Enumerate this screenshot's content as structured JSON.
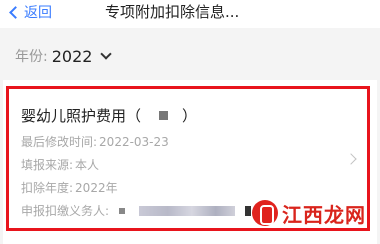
{
  "header": {
    "back_label": "返回",
    "title": "专项附加扣除信息..."
  },
  "filter": {
    "year_label": "年份:",
    "year_value": "2022"
  },
  "record": {
    "title": "婴幼儿照护费用（",
    "title_close": "）",
    "modified_label": "最后修改时间:",
    "modified_value": "2022-03-23",
    "source_label": "填报来源:",
    "source_value": "本人",
    "deduct_year_label": "扣除年度:",
    "deduct_year_value": "2022年",
    "withholder_label": "申报扣缴义务人:"
  },
  "watermark": {
    "text": "江西龙网"
  },
  "colors": {
    "accent": "#3a7cff",
    "highlight_border": "#e8141c"
  }
}
